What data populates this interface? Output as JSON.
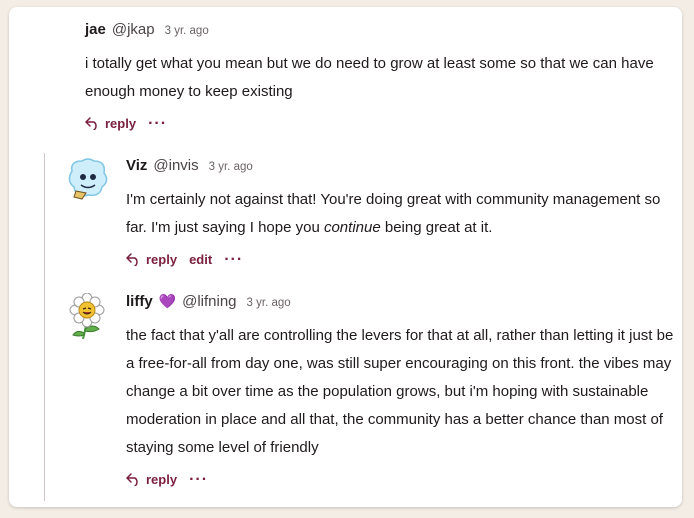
{
  "comments": [
    {
      "name": "jae",
      "handle": "@jkap",
      "time": "3 yr. ago",
      "body": "i totally get what you mean but we do need to grow at least some so that we can have enough money to keep existing",
      "actions": {
        "reply": "reply",
        "more": "···"
      }
    },
    {
      "name": "Viz",
      "handle": "@invis",
      "time": "3 yr. ago",
      "body_before": "I'm certainly not against that! You're doing great with community management so far. I'm just saying I hope you ",
      "body_em": "continue",
      "body_after": " being great at it.",
      "actions": {
        "reply": "reply",
        "edit": "edit",
        "more": "···"
      }
    },
    {
      "name": "liffy",
      "heart": "💜",
      "handle": "@lifning",
      "time": "3 yr. ago",
      "body": "the fact that y'all are controlling the levers for that at all, rather than letting it just be a free-for-all from day one, was still super encouraging on this front. the vibes may change a bit over time as the population grows, but i'm hoping with sustainable moderation in place and all that, the community has a better chance than most of staying some level of friendly",
      "actions": {
        "reply": "reply",
        "more": "···"
      }
    }
  ],
  "colors": {
    "accent": "#7a1f3d",
    "thread_line": "#cfc7c9"
  }
}
